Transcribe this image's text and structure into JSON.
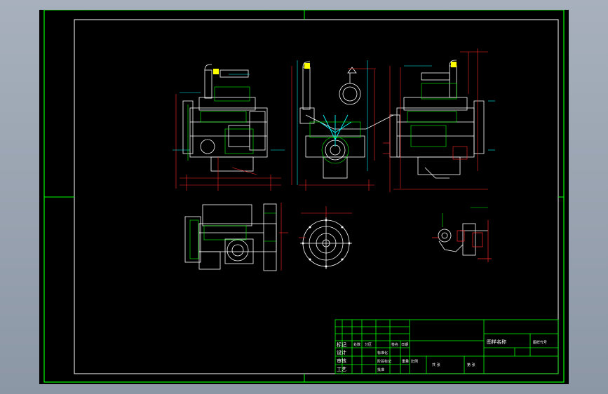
{
  "colors": {
    "background": "#000000",
    "frame": "#00ff00",
    "drawing_white": "#ffffff",
    "dimension_red": "#ff2a2a",
    "dimension_cyan": "#00ffff",
    "accent_yellow": "#ffff00",
    "accent_magenta": "#ff00ff",
    "viewport_gray": "#9aa4b1"
  },
  "title_block": {
    "labels": {
      "mark": "标记",
      "count": "处数",
      "division": "分区",
      "design": "设计",
      "standardize": "标准化",
      "review": "审核",
      "process": "工艺",
      "approve": "批准",
      "stage_mark": "阶段标记",
      "weight": "重量",
      "scale": "比例",
      "drawing_name": "图样名称",
      "drawing_no": "图样代号",
      "sheet_total": "共 张",
      "sheet_no": "第 张",
      "date": "日期",
      "signature": "签名"
    }
  },
  "views": [
    {
      "name": "side-view-left"
    },
    {
      "name": "front-view"
    },
    {
      "name": "side-view-right"
    },
    {
      "name": "top-view"
    },
    {
      "name": "flywheel-view"
    },
    {
      "name": "detail-view"
    }
  ]
}
